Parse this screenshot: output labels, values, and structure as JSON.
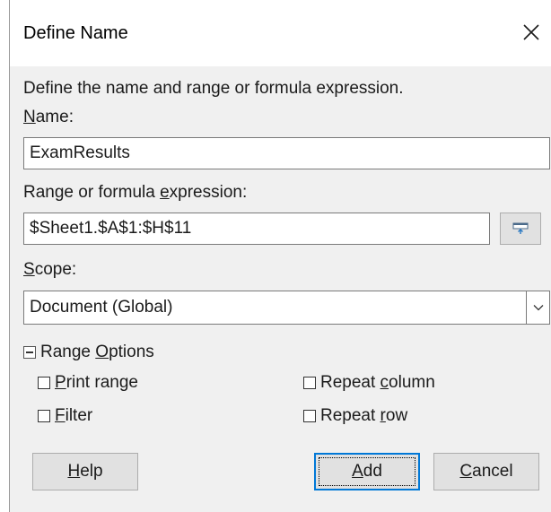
{
  "dialog": {
    "title": "Define Name",
    "description": "Define the name and range or formula expression."
  },
  "name": {
    "label_accel": "N",
    "label_rest": "ame:",
    "value": "ExamResults"
  },
  "range": {
    "label_pre": "Range or formula ",
    "label_accel": "e",
    "label_post": "xpression:",
    "value": "$Sheet1.$A$1:$H$11"
  },
  "scope": {
    "label_accel": "S",
    "label_rest": "cope:",
    "value": "Document (Global)"
  },
  "range_options": {
    "label_pre": "Range ",
    "label_accel": "O",
    "label_post": "ptions",
    "print_range": {
      "accel": "P",
      "rest": "rint range"
    },
    "filter": {
      "accel": "F",
      "rest": "ilter"
    },
    "repeat_column": {
      "pre": "Repeat ",
      "accel": "c",
      "post": "olumn"
    },
    "repeat_row": {
      "pre": "Repeat ",
      "accel": "r",
      "post": "ow"
    }
  },
  "buttons": {
    "help": {
      "accel": "H",
      "rest": "elp"
    },
    "add": {
      "accel": "A",
      "rest": "dd"
    },
    "cancel": {
      "accel": "C",
      "rest": "ancel"
    }
  },
  "icons": {
    "close": "close-icon",
    "shrink": "shrink-dialog-icon",
    "dropdown": "chevron-down-icon",
    "collapse": "collapse-icon"
  }
}
